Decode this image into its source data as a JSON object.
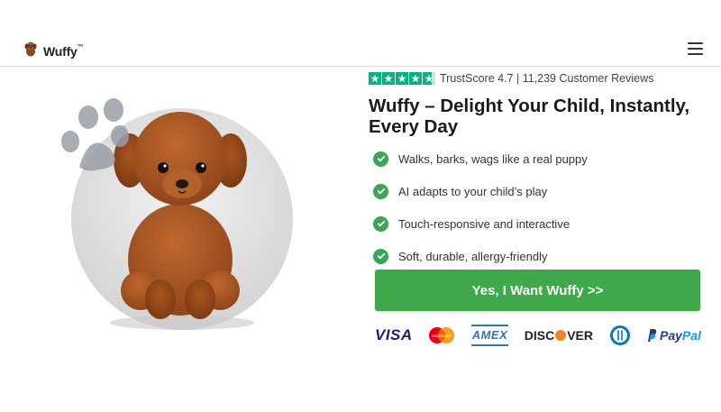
{
  "header": {
    "logo_text": "Wuffy",
    "logo_mark": "™",
    "logo_icon": "puppy-icon",
    "menu_icon": "hamburger-menu-icon"
  },
  "trust": {
    "rating_stars": 4.7,
    "text": "TrustScore 4.7 | 11,239 Customer Reviews",
    "star_color": "#00b67a"
  },
  "hero": {
    "image": "plush-puppy-toy",
    "paw_icon": "paw-icon",
    "headline": "Wuffy – Delight Your Child, Instantly, Every Day"
  },
  "features": [
    {
      "label": "Walks, barks, wags like a real puppy",
      "icon": "check-circle-icon"
    },
    {
      "label": "AI adapts to your child’s play",
      "icon": "check-circle-icon"
    },
    {
      "label": "Touch-responsive and interactive",
      "icon": "check-circle-icon"
    },
    {
      "label": "Soft, durable, allergy-friendly",
      "icon": "check-circle-icon"
    }
  ],
  "cta": {
    "label": "Yes, I Want Wuffy >>",
    "color": "#3fa84a"
  },
  "payments": {
    "visa": "VISA",
    "mastercard": "mastercard",
    "amex": "AMEX",
    "discover_a": "DISC",
    "discover_b": "VER",
    "diners": "diners-club-icon",
    "paypal_a": "Pay",
    "paypal_b": "Pal"
  }
}
